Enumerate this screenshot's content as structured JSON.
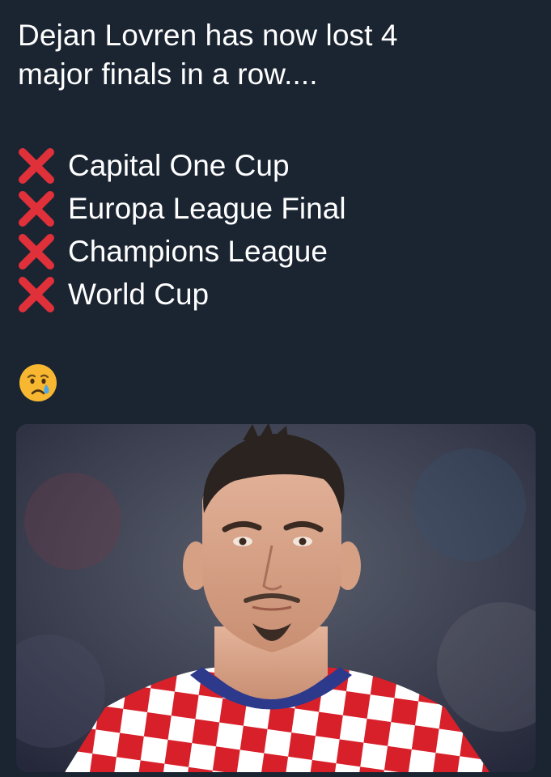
{
  "tweet": {
    "headline_line1": "Dejan Lovren has now lost 4",
    "headline_line2": "major finals in a row....",
    "finals": [
      {
        "label": "Capital One Cup",
        "icon": "cross-mark-icon"
      },
      {
        "label": "Europa League Final",
        "icon": "cross-mark-icon"
      },
      {
        "label": "Champions League",
        "icon": "cross-mark-icon"
      },
      {
        "label": "World Cup",
        "icon": "cross-mark-icon"
      }
    ],
    "emoji": "crying-face-icon",
    "media": {
      "subject": "player-photo"
    }
  },
  "colors": {
    "background": "#1b2532",
    "text": "#ffffff",
    "cross": "#e0303a",
    "kit_red": "#d8202a"
  }
}
